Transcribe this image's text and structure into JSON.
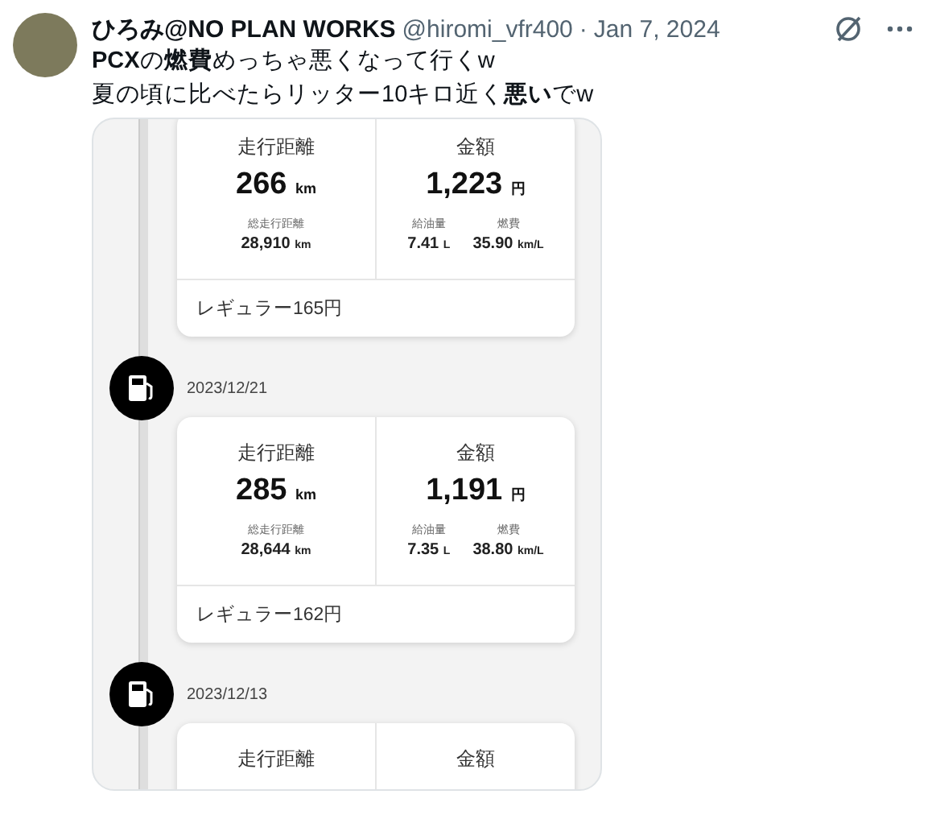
{
  "tweet": {
    "author_name": "ひろみ@NO PLAN WORKS",
    "handle": "@hiromi_vfr400",
    "separator": "·",
    "date": "Jan 7, 2024",
    "lines": [
      "**PCX**の**燃費**めっちゃ悪くなって行くw",
      "夏の頃に比べたらリッター10キロ近く**悪い**でw"
    ]
  },
  "screenshot": {
    "entries": [
      {
        "distance_label": "走行距離",
        "distance": "266",
        "distance_unit": "km",
        "amount_label": "金額",
        "amount": "1,223",
        "amount_unit": "円",
        "total_label": "総走行距離",
        "total": "28,910",
        "total_unit": "km",
        "fuel_label": "給油量",
        "fuel": "7.41",
        "fuel_unit": "L",
        "efficiency_label": "燃費",
        "efficiency": "35.90",
        "efficiency_unit": "km/L",
        "fuel_type": "レギュラー165円"
      },
      {
        "date": "2023/12/21",
        "distance_label": "走行距離",
        "distance": "285",
        "distance_unit": "km",
        "amount_label": "金額",
        "amount": "1,191",
        "amount_unit": "円",
        "total_label": "総走行距離",
        "total": "28,644",
        "total_unit": "km",
        "fuel_label": "給油量",
        "fuel": "7.35",
        "fuel_unit": "L",
        "efficiency_label": "燃費",
        "efficiency": "38.80",
        "efficiency_unit": "km/L",
        "fuel_type": "レギュラー162円"
      },
      {
        "date": "2023/12/13",
        "distance_label": "走行距離",
        "amount_label": "金額"
      }
    ]
  }
}
